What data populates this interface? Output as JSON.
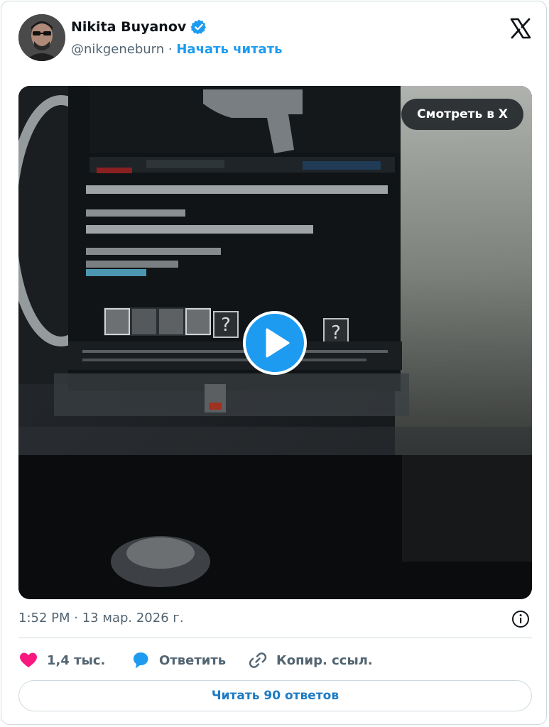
{
  "author": {
    "name": "Nikita Buyanov",
    "handle": "@nikgeneburn",
    "separator": "·",
    "follow_label": "Начать читать",
    "verified": true,
    "avatar_icon": "avatar-photo"
  },
  "brand": {
    "logo_icon": "x-logo-icon"
  },
  "media": {
    "type": "video",
    "watch_label": "Смотреть в X",
    "play_icon": "play-icon"
  },
  "meta": {
    "time": "1:52 PM",
    "separator": "·",
    "date": "13 мар. 2026 г.",
    "info_icon": "info-icon"
  },
  "actions": {
    "likes": "1,4 тыс.",
    "reply": "Ответить",
    "copy_link": "Копир. ссыл."
  },
  "read_replies": "Читать 90 ответов",
  "colors": {
    "accent": "#1d9bf0",
    "like": "#f91880",
    "text_primary": "#0f1419",
    "text_secondary": "#536471",
    "border": "#cfd9de"
  }
}
